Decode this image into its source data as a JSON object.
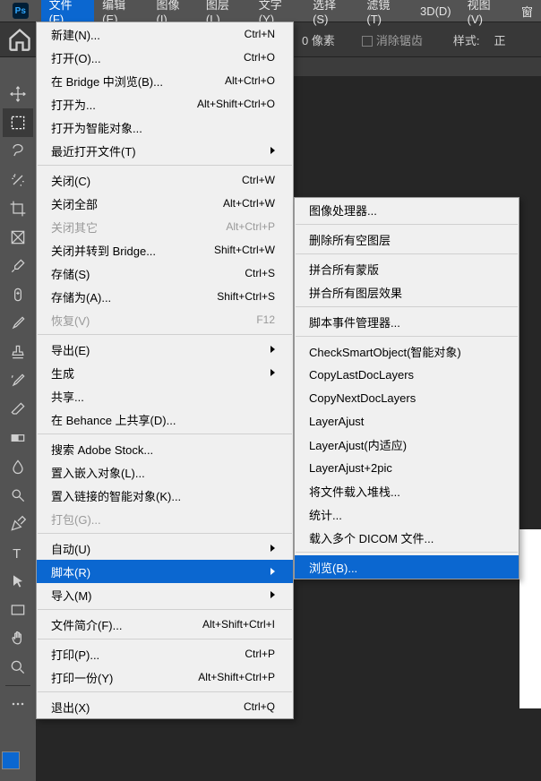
{
  "menubar": {
    "items": [
      "文件(F)",
      "编辑(E)",
      "图像(I)",
      "图层(L)",
      "文字(Y)",
      "选择(S)",
      "滤镜(T)",
      "3D(D)",
      "视图(V)",
      "窗"
    ]
  },
  "options": {
    "pixels": "0 像素",
    "antialias": "消除锯齿",
    "style": "样式:",
    "style_value": "正"
  },
  "file_menu": [
    {
      "label": "新建(N)...",
      "shortcut": "Ctrl+N"
    },
    {
      "label": "打开(O)...",
      "shortcut": "Ctrl+O"
    },
    {
      "label": "在 Bridge 中浏览(B)...",
      "shortcut": "Alt+Ctrl+O"
    },
    {
      "label": "打开为...",
      "shortcut": "Alt+Shift+Ctrl+O"
    },
    {
      "label": "打开为智能对象..."
    },
    {
      "label": "最近打开文件(T)",
      "arrow": true
    },
    {
      "sep": true
    },
    {
      "label": "关闭(C)",
      "shortcut": "Ctrl+W"
    },
    {
      "label": "关闭全部",
      "shortcut": "Alt+Ctrl+W"
    },
    {
      "label": "关闭其它",
      "shortcut": "Alt+Ctrl+P",
      "disabled": true
    },
    {
      "label": "关闭并转到 Bridge...",
      "shortcut": "Shift+Ctrl+W"
    },
    {
      "label": "存储(S)",
      "shortcut": "Ctrl+S"
    },
    {
      "label": "存储为(A)...",
      "shortcut": "Shift+Ctrl+S"
    },
    {
      "label": "恢复(V)",
      "shortcut": "F12",
      "disabled": true
    },
    {
      "sep": true
    },
    {
      "label": "导出(E)",
      "arrow": true
    },
    {
      "label": "生成",
      "arrow": true
    },
    {
      "label": "共享..."
    },
    {
      "label": "在 Behance 上共享(D)..."
    },
    {
      "sep": true
    },
    {
      "label": "搜索 Adobe Stock..."
    },
    {
      "label": "置入嵌入对象(L)..."
    },
    {
      "label": "置入链接的智能对象(K)..."
    },
    {
      "label": "打包(G)...",
      "disabled": true
    },
    {
      "sep": true
    },
    {
      "label": "自动(U)",
      "arrow": true
    },
    {
      "label": "脚本(R)",
      "arrow": true,
      "highlighted": true
    },
    {
      "label": "导入(M)",
      "arrow": true
    },
    {
      "sep": true
    },
    {
      "label": "文件简介(F)...",
      "shortcut": "Alt+Shift+Ctrl+I"
    },
    {
      "sep": true
    },
    {
      "label": "打印(P)...",
      "shortcut": "Ctrl+P"
    },
    {
      "label": "打印一份(Y)",
      "shortcut": "Alt+Shift+Ctrl+P"
    },
    {
      "sep": true
    },
    {
      "label": "退出(X)",
      "shortcut": "Ctrl+Q"
    }
  ],
  "scripts_submenu": [
    {
      "label": "图像处理器..."
    },
    {
      "sep": true
    },
    {
      "label": "删除所有空图层"
    },
    {
      "sep": true
    },
    {
      "label": "拼合所有蒙版"
    },
    {
      "label": "拼合所有图层效果"
    },
    {
      "sep": true
    },
    {
      "label": "脚本事件管理器..."
    },
    {
      "sep": true
    },
    {
      "label": "CheckSmartObject(智能对象)"
    },
    {
      "label": "CopyLastDocLayers"
    },
    {
      "label": "CopyNextDocLayers"
    },
    {
      "label": "LayerAjust"
    },
    {
      "label": "LayerAjust(内适应)"
    },
    {
      "label": "LayerAjust+2pic"
    },
    {
      "label": "将文件载入堆栈..."
    },
    {
      "label": "统计..."
    },
    {
      "label": "载入多个 DICOM 文件..."
    },
    {
      "sep": true
    },
    {
      "label": "浏览(B)...",
      "highlighted": true
    }
  ],
  "logo": "Ps"
}
